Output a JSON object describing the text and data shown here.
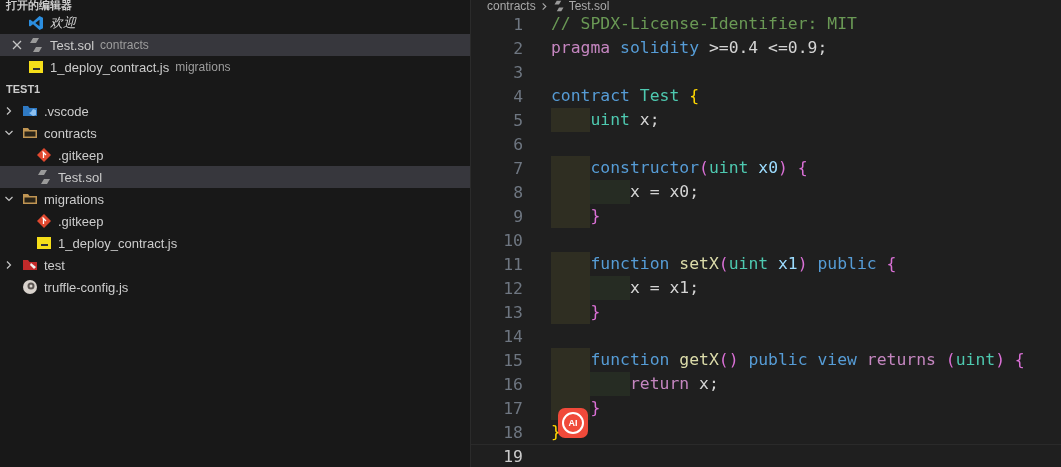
{
  "open_editors": {
    "title": "打开的编辑器",
    "items": [
      {
        "label": "欢迎",
        "kind": "vscode",
        "preview": true,
        "selected": false
      },
      {
        "label": "Test.sol",
        "description": "contracts",
        "kind": "solidity",
        "preview": false,
        "selected": true
      },
      {
        "label": "1_deploy_contract.js",
        "description": "migrations",
        "kind": "js",
        "preview": false,
        "selected": false
      }
    ]
  },
  "explorer": {
    "title": "TEST1",
    "items": [
      {
        "label": ".vscode",
        "kind": "folder-vscode",
        "expanded": false,
        "selected": false
      },
      {
        "label": "contracts",
        "kind": "folder",
        "expanded": true,
        "selected": false,
        "children": [
          {
            "label": ".gitkeep",
            "kind": "git",
            "selected": false
          },
          {
            "label": "Test.sol",
            "kind": "solidity",
            "selected": true
          }
        ]
      },
      {
        "label": "migrations",
        "kind": "folder",
        "expanded": true,
        "selected": false,
        "children": [
          {
            "label": ".gitkeep",
            "kind": "git",
            "selected": false
          },
          {
            "label": "1_deploy_contract.js",
            "kind": "js",
            "selected": false
          }
        ]
      },
      {
        "label": "test",
        "kind": "folder-test",
        "expanded": false,
        "selected": false
      },
      {
        "label": "truffle-config.js",
        "kind": "truffle",
        "selected": false
      }
    ]
  },
  "breadcrumb": [
    {
      "label": "contracts",
      "kind": "folder"
    },
    {
      "label": "Test.sol",
      "kind": "solidity"
    }
  ],
  "editor": {
    "lines": [
      {
        "number": "1",
        "kind": "top",
        "tokens": [
          {
            "text": "// SPDX-License-Identifier: MIT",
            "kind": "comment"
          }
        ]
      },
      {
        "number": "2",
        "kind": "top",
        "tokens": [
          {
            "text": "pragma",
            "kind": "control"
          },
          {
            "text": " solidity",
            "kind": "keyword"
          },
          {
            "text": " >=0.4 <=0.9;",
            "kind": "plain"
          }
        ]
      },
      {
        "number": "3"
      },
      {
        "number": "4",
        "kind": "top",
        "tokens": [
          {
            "text": "contract",
            "kind": "keyword"
          },
          {
            "text": " Test",
            "kind": "type"
          },
          {
            "text": " {",
            "kind": "bracket1"
          }
        ]
      },
      {
        "number": "5",
        "kind": "block",
        "tokens": [
          {
            "text": "uint",
            "kind": "type"
          },
          {
            "text": " x;",
            "kind": "plain"
          }
        ]
      },
      {
        "number": "6"
      },
      {
        "number": "7",
        "kind": "block",
        "tokens": [
          {
            "text": "constructor",
            "kind": "keyword"
          },
          {
            "text": "(",
            "kind": "bracket2"
          },
          {
            "text": "uint",
            "kind": "type"
          },
          {
            "text": " x0",
            "kind": "variable"
          },
          {
            "text": ")",
            "kind": "bracket2"
          },
          {
            "text": " {",
            "kind": "bracket2"
          }
        ]
      },
      {
        "number": "8",
        "kind": "inner",
        "tokens": [
          {
            "text": "x = x0;",
            "kind": "plain"
          }
        ]
      },
      {
        "number": "9",
        "kind": "block",
        "tokens": [
          {
            "text": "}",
            "kind": "bracket2"
          }
        ]
      },
      {
        "number": "10"
      },
      {
        "number": "11",
        "kind": "block",
        "tokens": [
          {
            "text": "function",
            "kind": "keyword"
          },
          {
            "text": " setX",
            "kind": "func"
          },
          {
            "text": "(",
            "kind": "bracket2"
          },
          {
            "text": "uint",
            "kind": "type"
          },
          {
            "text": " x1",
            "kind": "variable"
          },
          {
            "text": ")",
            "kind": "bracket2"
          },
          {
            "text": " public",
            "kind": "keyword"
          },
          {
            "text": " {",
            "kind": "bracket2"
          }
        ]
      },
      {
        "number": "12",
        "kind": "inner",
        "tokens": [
          {
            "text": "x = x1;",
            "kind": "plain"
          }
        ]
      },
      {
        "number": "13",
        "kind": "block",
        "tokens": [
          {
            "text": "}",
            "kind": "bracket2"
          }
        ]
      },
      {
        "number": "14"
      },
      {
        "number": "15",
        "kind": "block",
        "tokens": [
          {
            "text": "function",
            "kind": "keyword"
          },
          {
            "text": " getX",
            "kind": "func"
          },
          {
            "text": "()",
            "kind": "bracket2"
          },
          {
            "text": " public",
            "kind": "keyword"
          },
          {
            "text": " view",
            "kind": "keyword"
          },
          {
            "text": " returns",
            "kind": "control"
          },
          {
            "text": " (",
            "kind": "bracket2"
          },
          {
            "text": "uint",
            "kind": "type"
          },
          {
            "text": ")",
            "kind": "bracket2"
          },
          {
            "text": " {",
            "kind": "bracket2"
          }
        ]
      },
      {
        "number": "16",
        "kind": "inner",
        "tokens": [
          {
            "text": "return",
            "kind": "control"
          },
          {
            "text": " x;",
            "kind": "plain"
          }
        ]
      },
      {
        "number": "17",
        "kind": "block",
        "tokens": [
          {
            "text": "}",
            "kind": "bracket2"
          }
        ]
      },
      {
        "number": "18",
        "kind": "top",
        "tokens": [
          {
            "text": "}",
            "kind": "bracket1"
          }
        ]
      },
      {
        "number": "19",
        "current": true
      }
    ]
  },
  "ai_button": {
    "label": "AI"
  }
}
